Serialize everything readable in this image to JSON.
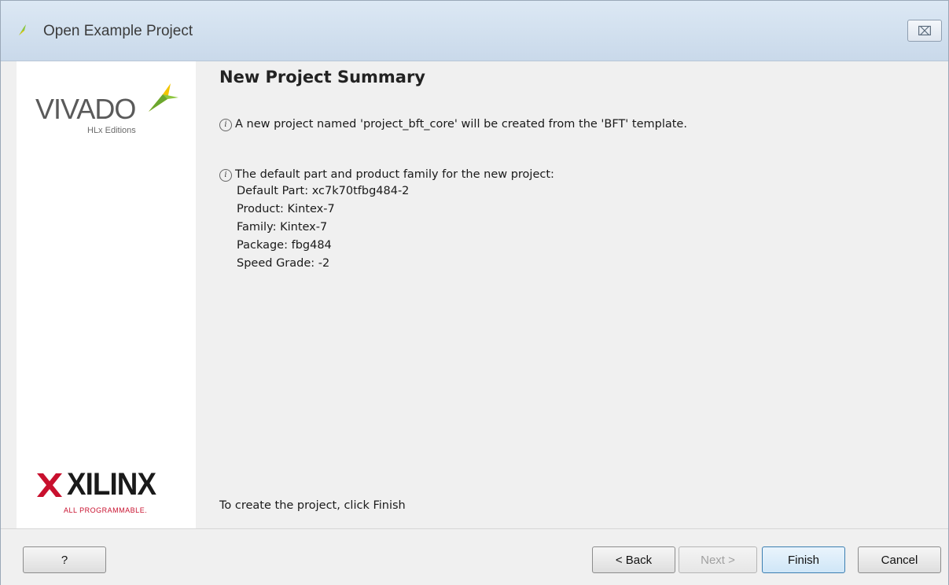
{
  "window": {
    "title": "Open Example Project",
    "close_glyph": "⌦"
  },
  "branding": {
    "vivado_name": "VIVADO",
    "vivado_edition": "HLx Editions",
    "xilinx_name": "XILINX",
    "xilinx_tagline": "ALL PROGRAMMABLE.",
    "colors": {
      "vivado_leaf_green": "#8dc63f",
      "vivado_leaf_yellow": "#f2c500",
      "xilinx_red": "#c8102e"
    }
  },
  "summary": {
    "heading": "New Project Summary",
    "project_line": "A new project named 'project_bft_core' will be created from the 'BFT' template.",
    "part_intro": "The default part and product family for the new project:",
    "details": [
      "Default Part: xc7k70tfbg484-2",
      "Product: Kintex-7",
      "Family: Kintex-7",
      "Package: fbg484",
      "Speed Grade: -2"
    ],
    "finish_hint": "To create the project, click Finish"
  },
  "buttons": {
    "help": "?",
    "back": "< Back",
    "next": "Next >",
    "finish": "Finish",
    "cancel": "Cancel"
  }
}
